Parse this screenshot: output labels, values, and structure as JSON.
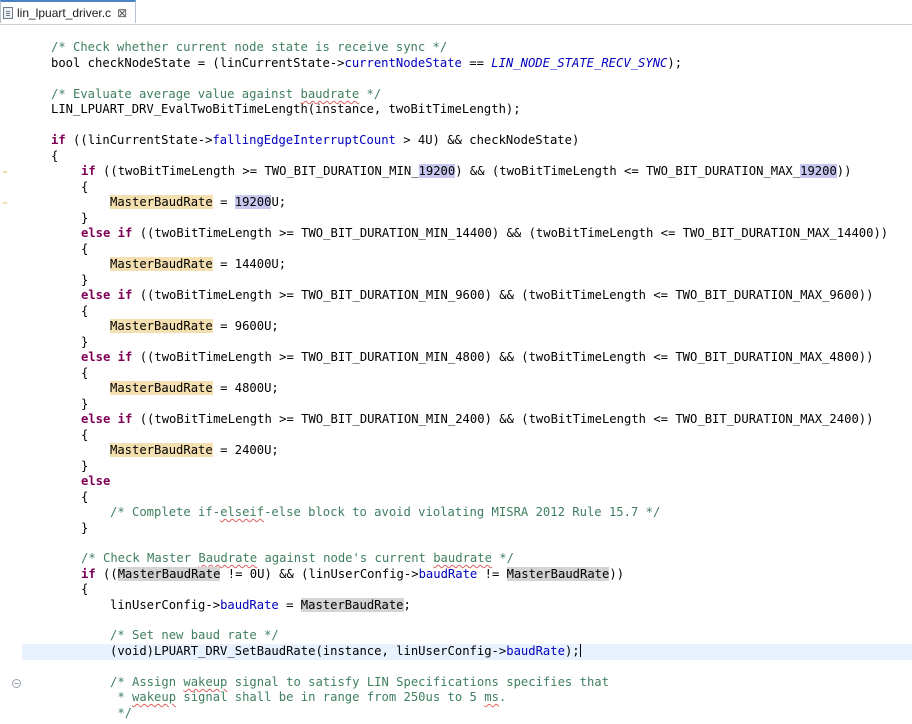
{
  "editor_tab": {
    "label": "lin_lpuart_driver.c",
    "close_glyph": "⊠"
  },
  "code": {
    "l1": "/* Check whether current node state is receive sync */",
    "l2": {
      "a": "bool checkNodeState = (linCurrentState->",
      "b": "currentNodeState",
      "c": " == ",
      "d": "LIN_NODE_STATE_RECV_SYNC",
      "e": ");"
    },
    "l4a": "/* Evaluate average value against ",
    "l4b": "baudrate",
    "l4c": " */",
    "l5": "LIN_LPUART_DRV_EvalTwoBitTimeLength(instance, twoBitTimeLength);",
    "l7": {
      "kw": "if",
      "a": " ((linCurrentState->",
      "b": "fallingEdgeInterruptCount",
      "c": " > 4U) && checkNodeState)"
    },
    "brace_open": "{",
    "brace_close": "}",
    "kw_if": "if",
    "kw_else_if": "else if",
    "kw_else": "else",
    "var": "MasterBaudRate",
    "b1": {
      "a": " ((twoBitTimeLength >= TWO_BIT_DURATION_MIN_",
      "b": "19200",
      "c": ") && (twoBitTimeLength <= TWO_BIT_DURATION_MAX_",
      "d": "19200",
      "e": "))"
    },
    "a1": {
      "a": " = ",
      "b": "19200",
      "c": "U;"
    },
    "b2": " ((twoBitTimeLength >= TWO_BIT_DURATION_MIN_14400) && (twoBitTimeLength <= TWO_BIT_DURATION_MAX_14400))",
    "a2": " = 14400U;",
    "b3": " ((twoBitTimeLength >= TWO_BIT_DURATION_MIN_9600) && (twoBitTimeLength <= TWO_BIT_DURATION_MAX_9600))",
    "a3": " = 9600U;",
    "b4": " ((twoBitTimeLength >= TWO_BIT_DURATION_MIN_4800) && (twoBitTimeLength <= TWO_BIT_DURATION_MAX_4800))",
    "a4": " = 4800U;",
    "b5": " ((twoBitTimeLength >= TWO_BIT_DURATION_MIN_2400) && (twoBitTimeLength <= TWO_BIT_DURATION_MAX_2400))",
    "a5": " = 2400U;",
    "else_cmt": {
      "a": "/* Complete if-",
      "b": "elseif",
      "c": "-else block to avoid violating MISRA 2012 Rule 15.7 */"
    },
    "c1": {
      "a": "/* Check Master ",
      "b": "Baudrate",
      "c": " against node's current ",
      "d": "baudrate",
      "e": " */"
    },
    "c2": {
      "a": " ((",
      "b": "MasterBaudRate",
      "c": " != 0U) && (linUserConfig->",
      "d": "baudRate",
      "e": " != ",
      "f": "MasterBaudRate",
      "g": "))"
    },
    "c3": {
      "a": "linUserConfig->",
      "b": "baudRate",
      "c": " = ",
      "d": "MasterBaudRate",
      "e": ";"
    },
    "c4": "/* Set new baud rate */",
    "c5": {
      "a": "(void)LPUART_DRV_SetBaudRate(instance, linUserConfig->",
      "b": "baudRate",
      "c": ");"
    },
    "c6": {
      "a": "/* Assign ",
      "b": "wakeup",
      "c": " signal to satisfy LIN Specifications specifies that"
    },
    "c7": {
      "a": " * ",
      "b": "wakeup",
      "c": " signal shall be in range from 250us to 5 ",
      "d": "ms",
      "e": "."
    },
    "c8": " */"
  },
  "colors": {
    "keyword": "#7f0055",
    "comment": "#3f7f5f",
    "field": "#0000c0",
    "occurrence": "#f4dfb0",
    "current_line": "#e8f2fe"
  }
}
